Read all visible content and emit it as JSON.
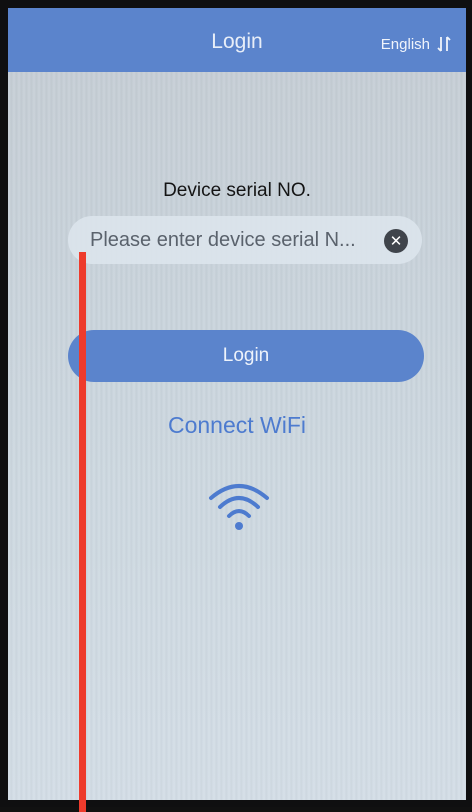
{
  "header": {
    "title": "Login",
    "language": "English",
    "language_icon": "sort-arrows-icon"
  },
  "form": {
    "serial_label": "Device serial NO.",
    "serial_placeholder": "Please enter device serial N...",
    "serial_value": "",
    "clear_icon": "clear-icon",
    "clear_glyph": "✕",
    "login_label": "Login"
  },
  "connect": {
    "label": "Connect WiFi",
    "icon": "wifi-icon"
  },
  "colors": {
    "accent": "#5b84cc",
    "link": "#4d7bcf",
    "annotation_line": "#ee3b2c"
  }
}
